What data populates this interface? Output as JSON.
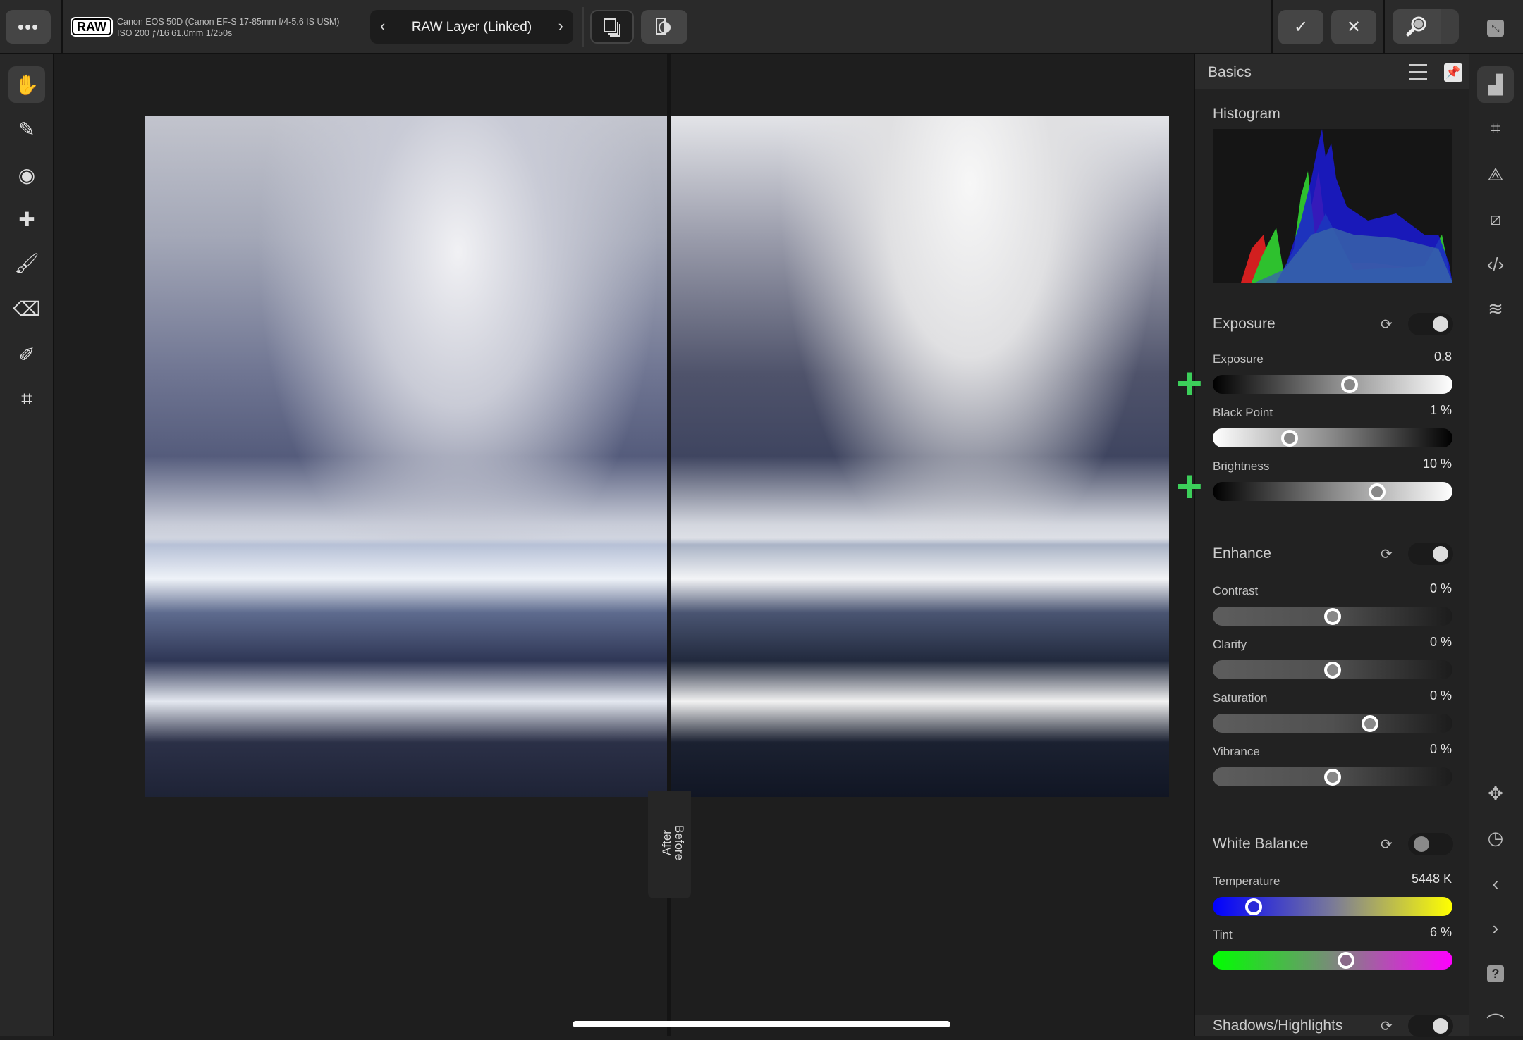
{
  "topbar": {
    "more_label": "•••",
    "raw_badge": "RAW",
    "camera_line1": "Canon EOS 50D (Canon EF-S 17-85mm f/4-5.6 IS USM)",
    "camera_line2": "ISO 200 ƒ/16 61.0mm 1/250s",
    "layer_prev": "‹",
    "layer_name": "RAW Layer (Linked)",
    "layer_next": "›",
    "apply_label": "✓",
    "cancel_label": "✕"
  },
  "left_tools": [
    {
      "icon": "hand-icon",
      "glyph": "✋",
      "active": true
    },
    {
      "icon": "selection-brush-icon",
      "glyph": "✎"
    },
    {
      "icon": "red-eye-icon",
      "glyph": "◉"
    },
    {
      "icon": "healing-bandage-icon",
      "glyph": "✚"
    },
    {
      "icon": "brush-icon",
      "glyph": "🖌"
    },
    {
      "icon": "eraser-icon",
      "glyph": "⌫"
    },
    {
      "icon": "gradient-brush-icon",
      "glyph": "✐"
    },
    {
      "icon": "crop-icon",
      "glyph": "⌗"
    }
  ],
  "canvas": {
    "after_label": "After",
    "before_label": "Before"
  },
  "panel": {
    "title": "Basics",
    "histogram_label": "Histogram",
    "sections": [
      {
        "title": "Exposure",
        "enabled": true,
        "sliders": [
          {
            "label": "Exposure",
            "value": "0.8",
            "position": 0.57,
            "gradient": "bw"
          },
          {
            "label": "Black Point",
            "value": "1 %",
            "position": 0.32,
            "gradient": "wb"
          },
          {
            "label": "Brightness",
            "value": "10 %",
            "position": 0.685,
            "gradient": "bw"
          }
        ]
      },
      {
        "title": "Enhance",
        "enabled": true,
        "sliders": [
          {
            "label": "Contrast",
            "value": "0 %",
            "position": 0.5,
            "gradient": "gray"
          },
          {
            "label": "Clarity",
            "value": "0 %",
            "position": 0.5,
            "gradient": "gray"
          },
          {
            "label": "Saturation",
            "value": "0 %",
            "position": 0.655,
            "gradient": "gray"
          },
          {
            "label": "Vibrance",
            "value": "0 %",
            "position": 0.5,
            "gradient": "gray"
          }
        ]
      },
      {
        "title": "White Balance",
        "enabled": false,
        "sliders": [
          {
            "label": "Temperature",
            "value": "5448 K",
            "position": 0.17,
            "gradient": "temp"
          },
          {
            "label": "Tint",
            "value": "6 %",
            "position": 0.555,
            "gradient": "tint"
          }
        ]
      },
      {
        "title": "Shadows/Highlights",
        "enabled": true,
        "sliders": []
      }
    ]
  },
  "right_strip": [
    {
      "icon": "histogram-studio-icon",
      "glyph": "▟",
      "active": true
    },
    {
      "icon": "grid-icon",
      "glyph": "⌗"
    },
    {
      "icon": "perspective-icon",
      "glyph": "⟁"
    },
    {
      "icon": "curves-icon",
      "glyph": "⧄"
    },
    {
      "icon": "code-icon",
      "glyph": "‹/›"
    },
    {
      "icon": "layers-icon",
      "glyph": "≋"
    },
    {
      "icon": "move-icon",
      "glyph": "✥"
    },
    {
      "icon": "history-icon",
      "glyph": "◷"
    },
    {
      "icon": "chevron-left-icon",
      "glyph": "‹"
    },
    {
      "icon": "chevron-right-icon",
      "glyph": "›"
    },
    {
      "icon": "help-icon",
      "glyph": "?"
    },
    {
      "icon": "pen-icon",
      "glyph": "⌒"
    }
  ]
}
